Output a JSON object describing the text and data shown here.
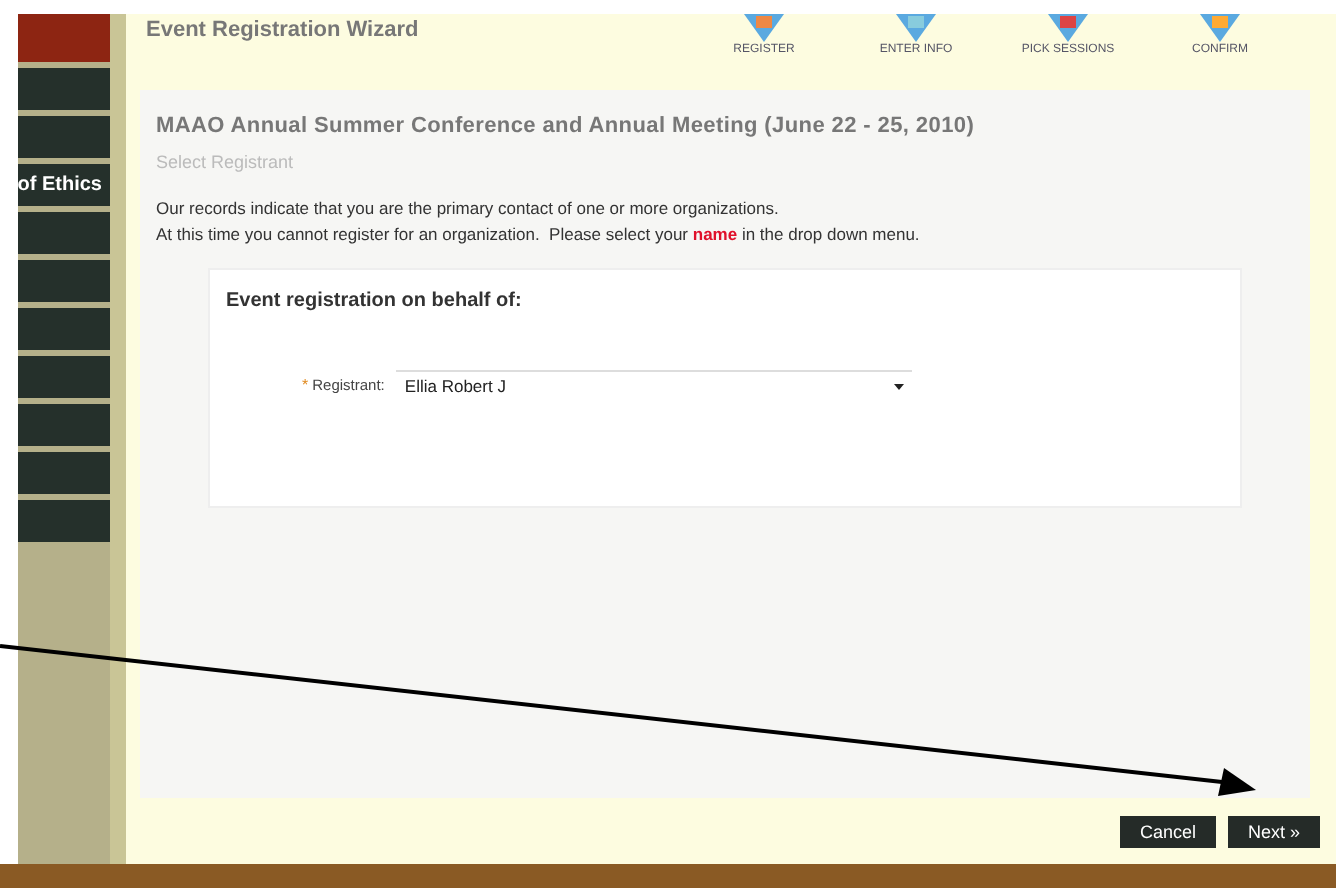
{
  "sidebar": {
    "items": [
      {
        "label": "of Ethics"
      }
    ]
  },
  "wizard": {
    "title": "Event Registration Wizard",
    "steps": [
      "REGISTER",
      "ENTER INFO",
      "PICK SESSIONS",
      "CONFIRM"
    ]
  },
  "event": {
    "title": "MAAO Annual Summer Conference and Annual Meeting (June 22 - 25, 2010)",
    "subtitle": "Select Registrant",
    "notice": [
      "Our records indicate that you are the primary contact of one or more organizations.",
      "At this time you cannot register for an organization.  Please select your **name** in the drop down menu."
    ]
  },
  "form": {
    "heading": "Event registration on behalf of:",
    "required_mark": "*",
    "label": "Registrant:",
    "value": "Ellia Robert J"
  },
  "buttons": [
    "Cancel",
    "Next »"
  ]
}
